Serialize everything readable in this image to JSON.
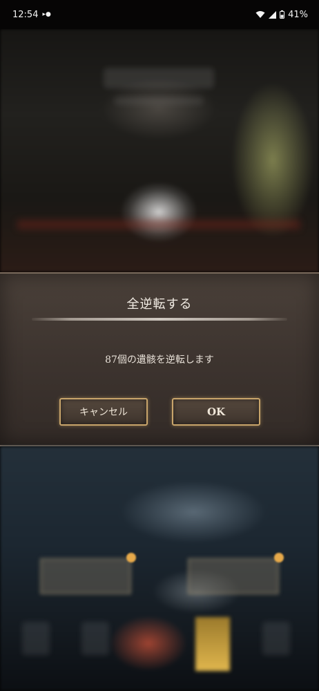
{
  "status_bar": {
    "time": "12:54",
    "notification_icons": "▸●",
    "battery": "41%"
  },
  "dialog": {
    "title": "全逆転する",
    "message": "87個の遺骸を逆転します",
    "cancel_label": "キャンセル",
    "ok_label": "OK"
  },
  "colors": {
    "button_border": "#c9a56b",
    "dialog_bg": "#3d342f",
    "text": "#f1ebe3"
  }
}
